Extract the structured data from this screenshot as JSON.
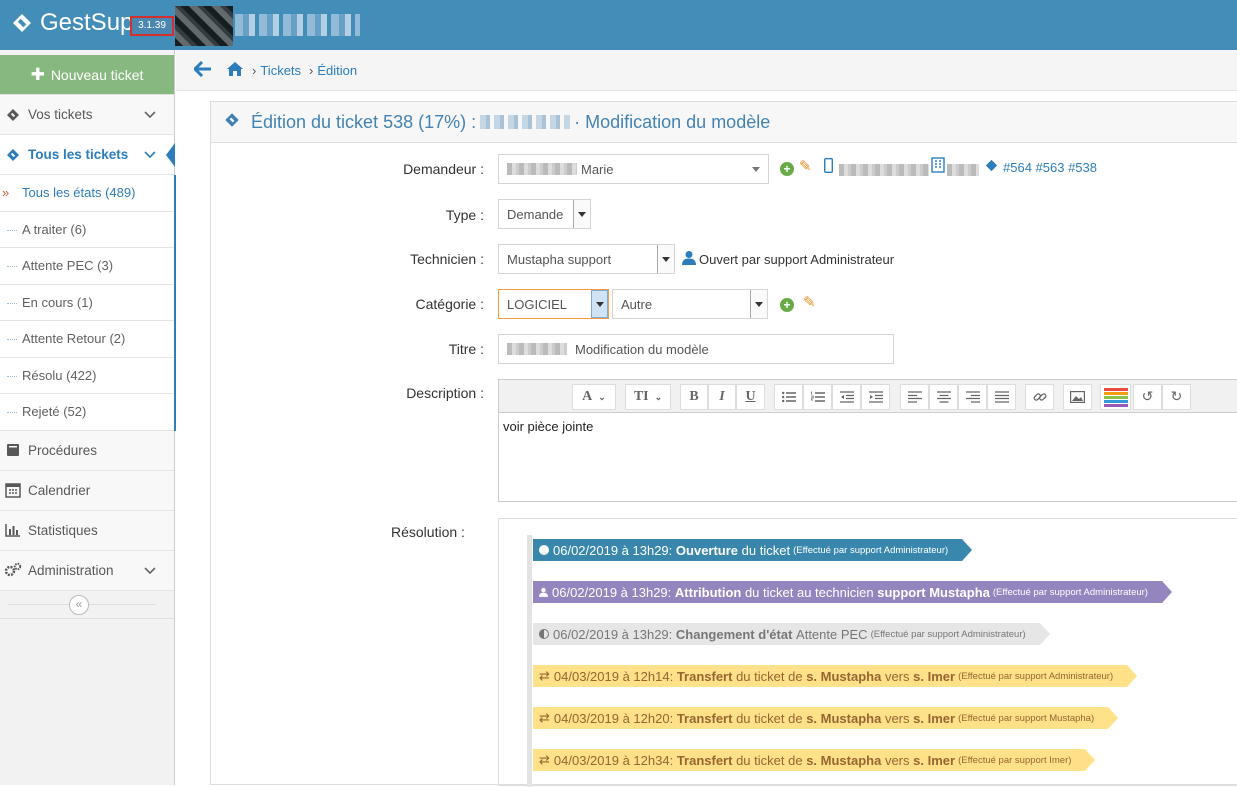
{
  "app": {
    "name": "GestSup",
    "version": "3.1.39"
  },
  "sidebar": {
    "new_ticket_label": "Nouveau ticket",
    "items": [
      {
        "label": "Vos tickets",
        "icon": "ticket-icon"
      },
      {
        "label": "Tous les tickets",
        "icon": "ticket-icon"
      },
      {
        "label": "Procédures",
        "icon": "book-icon"
      },
      {
        "label": "Calendrier",
        "icon": "calendar-icon"
      },
      {
        "label": "Statistiques",
        "icon": "bar-chart-icon"
      },
      {
        "label": "Administration",
        "icon": "cogs-icon"
      }
    ],
    "subitems": [
      {
        "label": "Tous les états (489)"
      },
      {
        "label": "A traiter (6)"
      },
      {
        "label": "Attente PEC (3)"
      },
      {
        "label": "En cours (1)"
      },
      {
        "label": "Attente Retour (2)"
      },
      {
        "label": "Résolu (422)"
      },
      {
        "label": "Rejeté (52)"
      }
    ]
  },
  "breadcrumb": {
    "tickets": "Tickets",
    "edition": "Édition"
  },
  "ticket": {
    "header_prefix": "Édition du ticket 538 (17%) :",
    "header_suffix": "· Modification du modèle",
    "labels": {
      "demandeur": "Demandeur :",
      "type": "Type :",
      "technicien": "Technicien :",
      "categorie": "Catégorie :",
      "titre": "Titre :",
      "description": "Description :",
      "resolution": "Résolution :"
    },
    "demandeur_value": "Marie",
    "related_tickets": "#564 #563 #538",
    "type_value": "Demande",
    "technicien_value": "Mustapha support",
    "opened_by": "Ouvert par support Administrateur",
    "categorie_value": "LOGICIEL",
    "subcategorie_value": "Autre",
    "titre_value": "Modification du modèle",
    "description_text": "voir pièce jointe"
  },
  "timeline": [
    {
      "date": "06/02/2019 à 13h29:",
      "action": "Ouverture",
      "text": "du ticket",
      "by": "(Effectué par support Administrateur)",
      "color": "#3a87ad"
    },
    {
      "date": "06/02/2019 à 13h29:",
      "action": "Attribution",
      "text": "du ticket au technicien",
      "extra": "support Mustapha",
      "by": "(Effectué par support Administrateur)",
      "color": "#9585bf"
    },
    {
      "date": "06/02/2019 à 13h29:",
      "action": "Changement d'état",
      "text": "Attente PEC",
      "by": "(Effectué par support Administrateur)",
      "color": "#e6e6e6"
    },
    {
      "date": "04/03/2019 à 12h14:",
      "action": "Transfert",
      "text": "du ticket de",
      "from": "s. Mustapha",
      "vers": "vers",
      "to": "s. Imer",
      "by": "(Effectué par support Administrateur)",
      "color": "#fee188"
    },
    {
      "date": "04/03/2019 à 12h20:",
      "action": "Transfert",
      "text": "du ticket de",
      "from": "s. Mustapha",
      "vers": "vers",
      "to": "s. Imer",
      "by": "(Effectué par support Mustapha)",
      "color": "#fee188"
    },
    {
      "date": "04/03/2019 à 12h34:",
      "action": "Transfert",
      "text": "du ticket de",
      "from": "s. Mustapha",
      "vers": "vers",
      "to": "s. Imer",
      "by": "(Effectué par support Imer)",
      "color": "#fee188"
    }
  ]
}
